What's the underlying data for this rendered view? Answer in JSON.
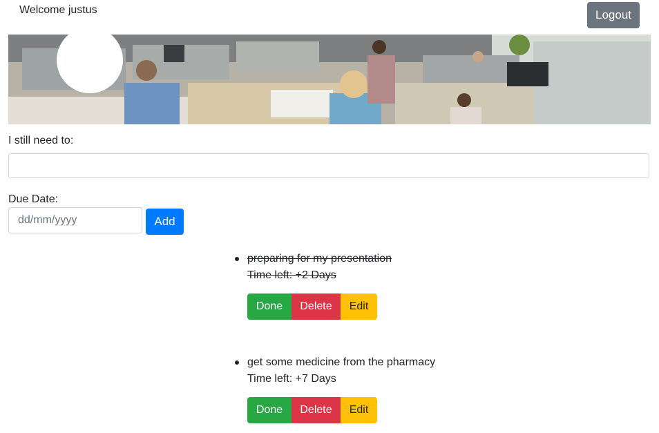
{
  "header": {
    "welcome_text": "Welcome justus",
    "logout_label": "Logout"
  },
  "form": {
    "task_label": "I still need to:",
    "task_value": "",
    "due_label": "Due Date:",
    "date_placeholder": "dd/mm/yyyy",
    "add_label": "Add"
  },
  "tasks": [
    {
      "title": "preparing for my presentation",
      "time_left": "Time left: +2 Days",
      "completed": true,
      "done_label": "Done",
      "delete_label": "Delete",
      "edit_label": "Edit"
    },
    {
      "title": "get some medicine from the pharmacy",
      "time_left": "Time left: +7 Days",
      "completed": false,
      "done_label": "Done",
      "delete_label": "Delete",
      "edit_label": "Edit"
    }
  ],
  "colors": {
    "logout": "#6c757d",
    "add": "#007bff",
    "done": "#28a745",
    "delete": "#dc3545",
    "edit": "#ffc107"
  }
}
